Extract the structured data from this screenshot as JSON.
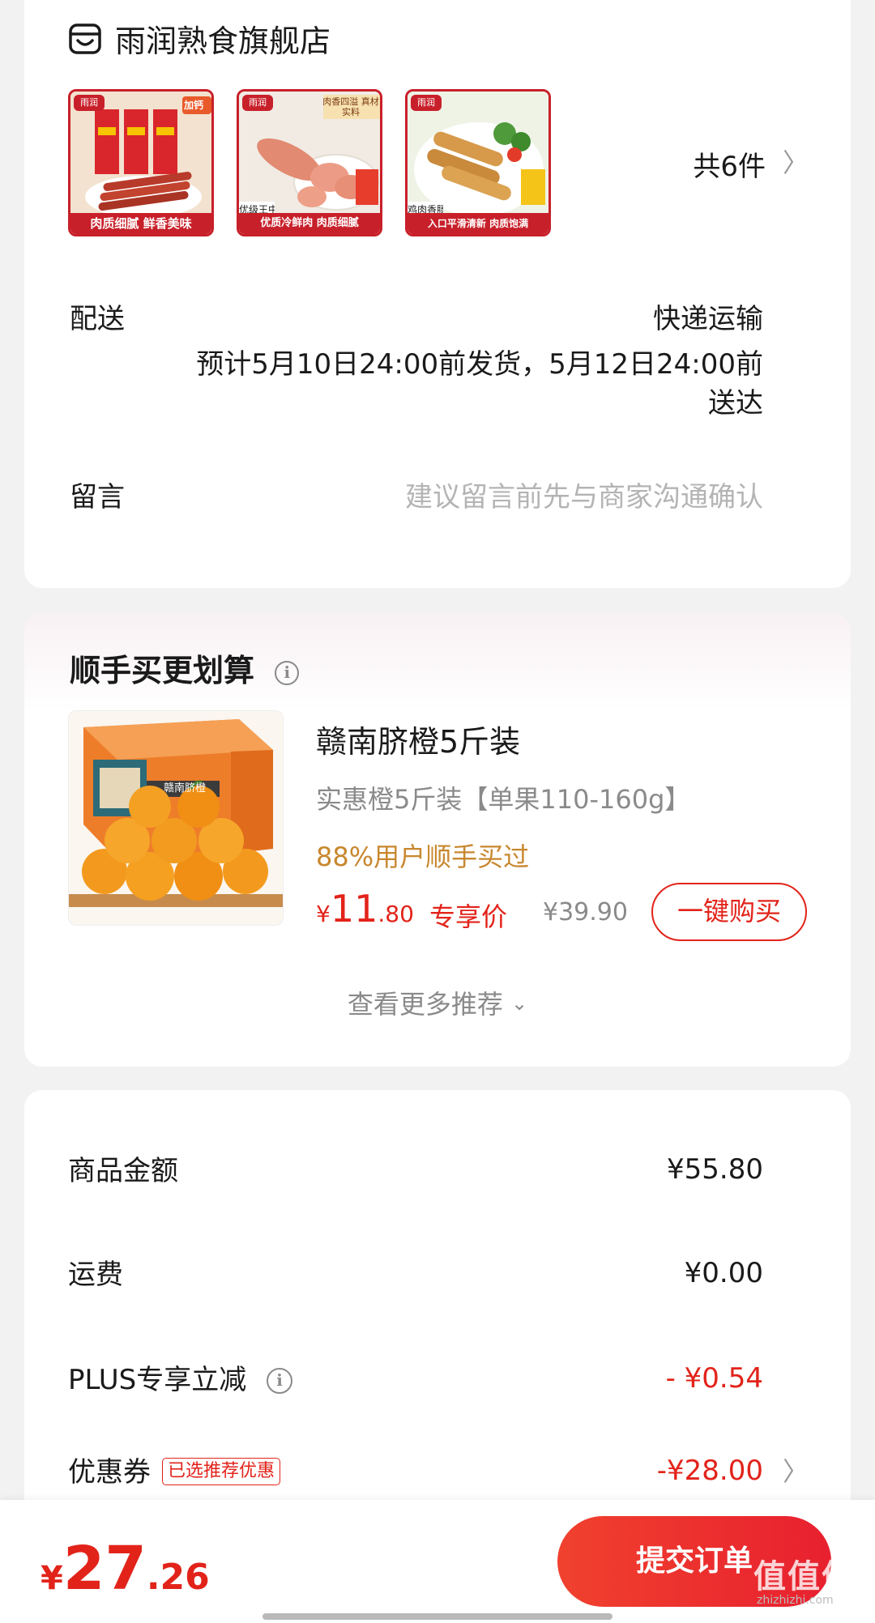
{
  "store": {
    "icon": "store-icon",
    "name": "雨润熟食旗舰店",
    "thumbs": [
      {
        "logo": "雨润",
        "bar": "肉质细腻  鲜香美味",
        "corner": "加钙",
        "tag": ""
      },
      {
        "logo": "雨润",
        "bar": "优质冷鲜肉 肉质细腻",
        "corner": "肉香四溢 真材实料",
        "tag": "优级王中王"
      },
      {
        "logo": "雨润",
        "bar": "入口平滑清新 肉质饱满",
        "corner": "",
        "tag": "鸡肉香肠"
      }
    ],
    "count": "共6件",
    "delivery_label": "配送",
    "delivery_method": "快递运输",
    "delivery_estimate_line1": "预计5月10日24:00前发货，5月12日24:00前",
    "delivery_estimate_line2": "送达",
    "message_label": "留言",
    "message_placeholder": "建议留言前先与商家沟通确认"
  },
  "recommend": {
    "title": "顺手买更划算",
    "product": {
      "name": "赣南脐橙5斤装",
      "spec": "实惠橙5斤装【单果110-160g】",
      "social": "88%用户顺手买过",
      "price_currency": "¥",
      "price_int": "11",
      "price_dec": ".80",
      "price_tag": "专享价",
      "original_price": "¥39.90",
      "buy_label": "一键购买",
      "box_text": "赣南脐橙"
    },
    "more_label": "查看更多推荐"
  },
  "summary": {
    "rows": [
      {
        "label": "商品金额",
        "value": "¥55.80"
      },
      {
        "label": "运费",
        "value": "¥0.00"
      },
      {
        "label": "PLUS专享立减",
        "value": "- ¥0.54"
      },
      {
        "label": "优惠券",
        "value": "-¥28.00",
        "tag": "已选推荐优惠"
      }
    ]
  },
  "footer": {
    "total_currency": "¥",
    "total_int": "27",
    "total_dec": ".26",
    "submit_label": "提交订单",
    "watermark": "值值值",
    "watermark_url": "zhizhizhi.com"
  },
  "colors": {
    "accent": "#e2231a",
    "brand_red": "#c8202a",
    "social_gold": "#c8872e",
    "muted": "#8a8a8a"
  }
}
